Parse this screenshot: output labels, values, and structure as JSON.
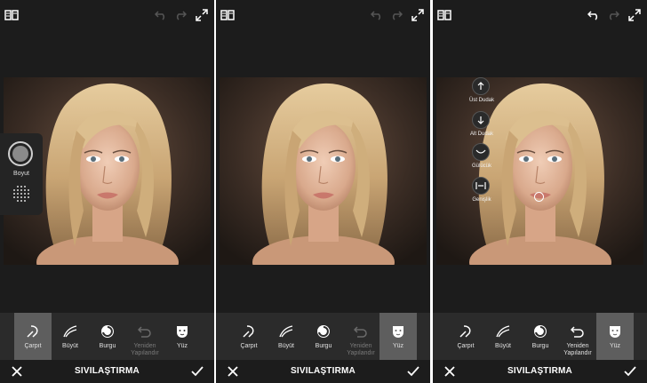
{
  "title": "SIVILAŞTIRMA",
  "tools": {
    "carpit": "Çarpıt",
    "buyut": "Büyüt",
    "burgu": "Burgu",
    "yeniden_line1": "Yeniden",
    "yeniden_line2": "Yapılandır",
    "yuz": "Yüz"
  },
  "side_panel": {
    "size_label": "Boyut"
  },
  "face_sliders": [
    {
      "label": "Üst Dudak",
      "icon": "arrow-up-icon"
    },
    {
      "label": "Alt Dudak",
      "icon": "arrow-down-icon"
    },
    {
      "label": "Gülücük",
      "icon": "smile-icon"
    },
    {
      "label": "Genişlik",
      "icon": "width-icon"
    }
  ],
  "panels": [
    {
      "active_tool": "carpit",
      "undo_enabled": false,
      "yeniden_enabled": false
    },
    {
      "active_tool": "yuz",
      "undo_enabled": false,
      "yeniden_enabled": false
    },
    {
      "active_tool": "yuz",
      "undo_enabled": true,
      "yeniden_enabled": true
    }
  ],
  "colors": {
    "background": "#1c1c1c",
    "toolbar": "#2b2b2b",
    "active_tool": "#5e5e5e",
    "accent": "#ffffff"
  }
}
